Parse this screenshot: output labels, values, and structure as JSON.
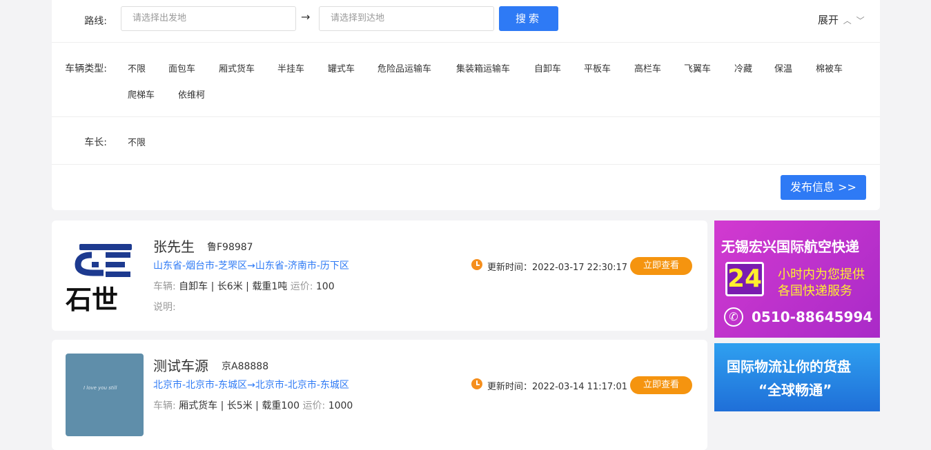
{
  "filters": {
    "route_label": "路线:",
    "origin_placeholder": "请选择出发地",
    "arrow": "→",
    "destination_placeholder": "请选择到达地",
    "search_label": "搜索",
    "expand_label": "展开",
    "vehicle_type_label": "车辆类型:",
    "vehicle_types": [
      "不限",
      "面包车",
      "厢式货车",
      "半挂车",
      "罐式车",
      "危险品运输车",
      "集装箱运输车",
      "自卸车",
      "平板车",
      "高栏车",
      "飞翼车",
      "冷藏",
      "保温",
      "棉被车",
      "爬梯车",
      "依维柯"
    ],
    "length_label": "车长:",
    "length_value": "不限",
    "publish_label": "发布信息 >>"
  },
  "listings": [
    {
      "logo_text": "石世",
      "name": "张先生",
      "plate": "鲁F98987",
      "route": "山东省-烟台市-芝罘区→山东省-济南市-历下区",
      "vehicle_label": "车辆:",
      "vehicle_type": "自卸车",
      "length": "长6米",
      "weight": "载重1吨",
      "price_label": "运价:",
      "price": "100",
      "note_label": "说明:",
      "updated": "更新时间：2022-03-17 22:30:17",
      "view_label": "立即查看"
    },
    {
      "logo_text": "I love you still",
      "name": "测试车源",
      "plate": "京A88888",
      "route": "北京市-北京市-东城区→北京市-北京市-东城区",
      "vehicle_label": "车辆:",
      "vehicle_type": "厢式货车",
      "length": "长5米",
      "weight": "载重100",
      "price_label": "运价:",
      "price": "1000",
      "updated": "更新时间：2022-03-14 11:17:01",
      "view_label": "立即查看"
    }
  ],
  "ads": [
    {
      "title": "无锡宏兴国际航空快递",
      "number": "24",
      "line1": "小时内为您提供",
      "line2": "各国快递服务",
      "phone": "0510-88645994",
      "bg": "#c532c9"
    },
    {
      "title": "国际物流让你的货盘",
      "subtitle": "“全球畅通”",
      "bg": "#2c8de0"
    }
  ],
  "colors": {
    "primary": "#2e7af5",
    "accent": "#f5940f"
  }
}
